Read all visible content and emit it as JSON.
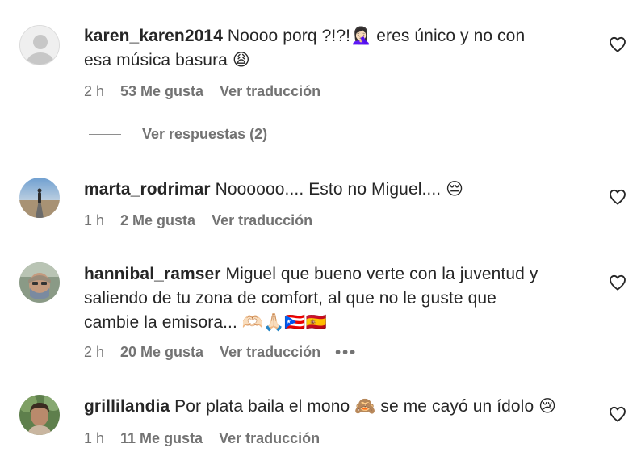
{
  "comments": [
    {
      "username": "karen_karen2014",
      "text_line1": " Noooo porq ?!?!🤦🏻‍♀️ eres único y no con",
      "text_line2": "esa música basura 😩",
      "time": "2 h",
      "likes": "53 Me gusta",
      "translate": "Ver traducción",
      "replies": "Ver respuestas (2)"
    },
    {
      "username": "marta_rodrimar",
      "text_line1": " Noooooo.... Esto no Miguel.... 😔",
      "time": "1 h",
      "likes": "2 Me gusta",
      "translate": "Ver traducción"
    },
    {
      "username": "hannibal_ramser",
      "text_line1": " Miguel que bueno verte con la juventud y",
      "text_line2": "saliendo de tu zona de comfort, al que no le guste que",
      "text_line3": "cambie la emisora... 🫶🏻🙏🏻🇵🇷🇪🇸",
      "time": "2 h",
      "likes": "20 Me gusta",
      "translate": "Ver traducción",
      "more": "•••"
    },
    {
      "username": "grillilandia",
      "text_line1": " Por plata baila el mono 🙈 se me cayó un ídolo 😢",
      "time": "1 h",
      "likes": "11 Me gusta",
      "translate": "Ver traducción"
    }
  ],
  "icons": {
    "heart": "heart-outline-icon",
    "avatar_default": "default-avatar-icon"
  },
  "colors": {
    "text": "#262626",
    "secondary": "#737373",
    "background": "#ffffff"
  }
}
